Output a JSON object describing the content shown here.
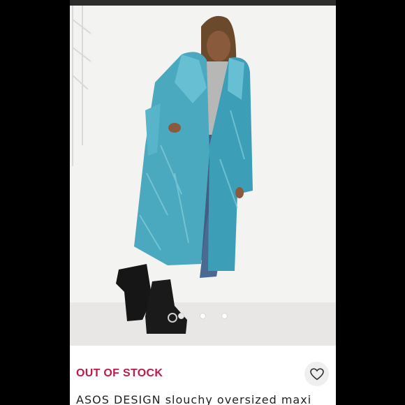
{
  "listing": {
    "status_text": "OUT OF STOCK",
    "title": "ASOS DESIGN slouchy oversized maxi",
    "accent_color": "#c0194a",
    "carousel": {
      "count": 3,
      "active_index": 0
    }
  },
  "icons": {
    "like": "heart-outline-icon"
  }
}
